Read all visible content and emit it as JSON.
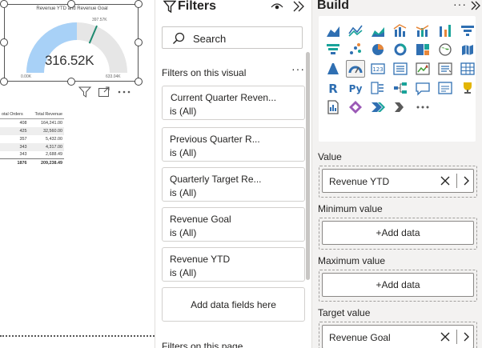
{
  "canvas": {
    "gauge": {
      "title": "Revenue YTD and Revenue Goal",
      "value": "316.52K",
      "min_label": "0.00K",
      "max_label": "633.04K",
      "target_label": "397.57K",
      "fill_fraction": 0.5,
      "target_fraction": 0.628,
      "fill_color": "#a8d1f7",
      "track_color": "#e6e6e6",
      "target_color": "#1f8a70"
    },
    "table": {
      "headers": [
        "otal Orders",
        "Total Revenue"
      ],
      "rows": [
        [
          "408",
          "164,241.00"
        ],
        [
          "425",
          "32,560.00"
        ],
        [
          "357",
          "5,432.00"
        ],
        [
          "343",
          "4,317.00"
        ],
        [
          "343",
          "2,688.49"
        ]
      ],
      "total": [
        "1876",
        "209,238.49"
      ]
    }
  },
  "filters": {
    "title": "Filters",
    "search_placeholder": "Search",
    "section_title": "Filters on this visual",
    "cards": [
      {
        "name": "Current Quarter Reven...",
        "value": "is (All)"
      },
      {
        "name": "Previous Quarter R...",
        "value": "is (All)"
      },
      {
        "name": "Quarterly Target Re...",
        "value": "is (All)"
      },
      {
        "name": "Revenue Goal",
        "value": "is (All)"
      },
      {
        "name": "Revenue YTD",
        "value": "is (All)"
      }
    ],
    "add_fields_label": "Add data fields here",
    "bottom_text": "Filters on this page"
  },
  "build": {
    "title": "Build",
    "gallery_icons": [
      "area-chart-icon",
      "line-chart-icon",
      "stacked-area-icon",
      "line-clustered-column-icon",
      "line-stacked-column-icon",
      "ribbon-chart-icon",
      "waterfall-icon",
      "funnel-icon",
      "scatter-icon",
      "pie-icon",
      "donut-icon",
      "treemap-icon",
      "map-icon",
      "filled-map-icon",
      "azure-map-icon",
      "gauge-icon",
      "card-icon",
      "multirow-card-icon",
      "kpi-icon",
      "slicer-icon",
      "table-icon",
      "r-visual-icon",
      "python-visual-icon",
      "key-influencers-icon",
      "decomposition-tree-icon",
      "qa-icon",
      "narrative-icon",
      "trophy-icon",
      "paginated-report-icon",
      "power-apps-icon",
      "power-automate-icon",
      "more-visuals-icon",
      "more-icon"
    ],
    "selected_icon": "gauge-icon",
    "wells": {
      "value": {
        "label": "Value",
        "field": "Revenue YTD"
      },
      "minimum": {
        "label": "Minimum value",
        "button": "+Add data"
      },
      "maximum": {
        "label": "Maximum value",
        "button": "+Add data"
      },
      "target": {
        "label": "Target value",
        "field": "Revenue Goal"
      }
    }
  }
}
